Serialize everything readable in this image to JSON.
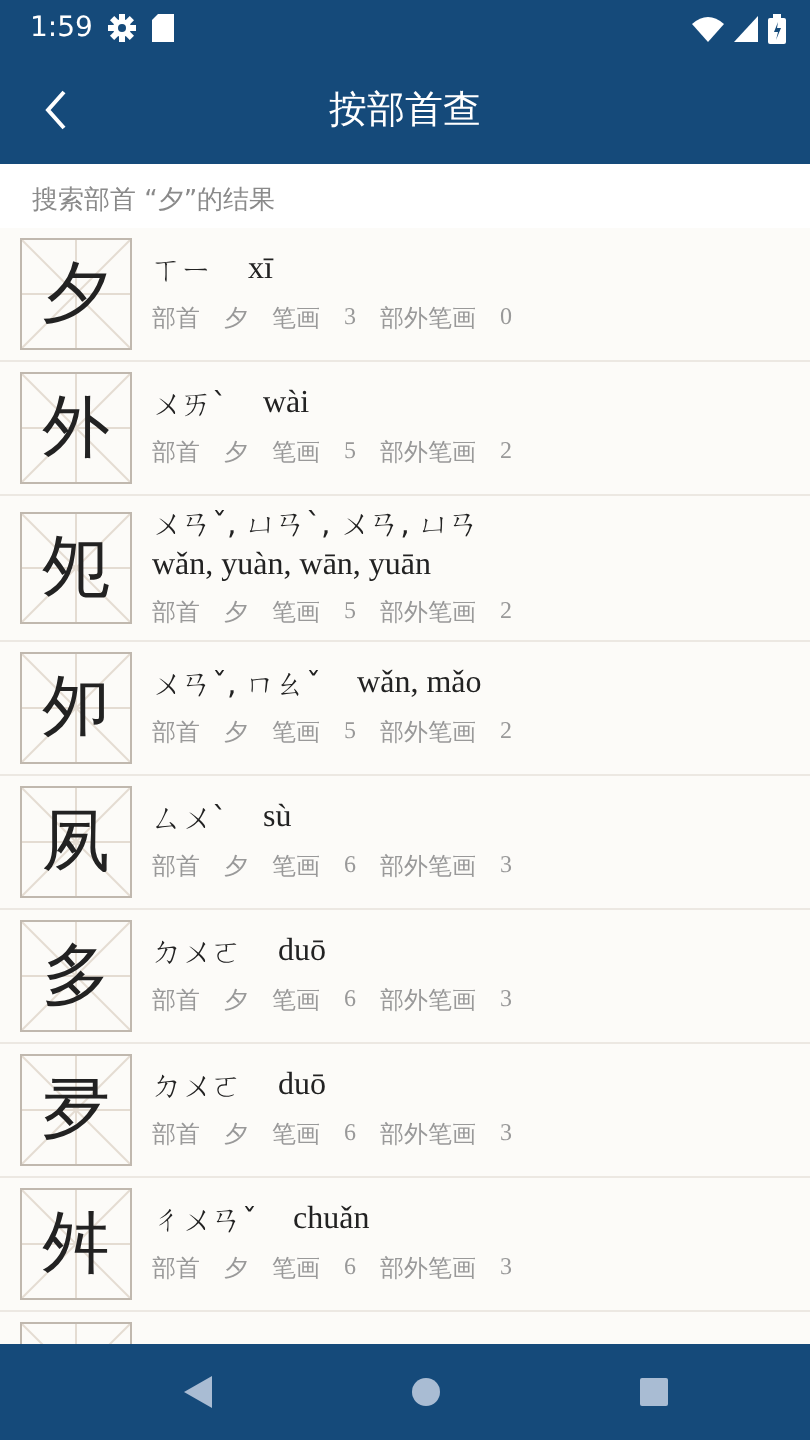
{
  "status_bar": {
    "time": "1:59"
  },
  "app_bar": {
    "title": "按部首查"
  },
  "subheader": "搜索部首 “夕”的结果",
  "rows": [
    {
      "character": "夕",
      "bopomofo": "ㄒㄧ",
      "pinyin": "xī",
      "meta": [
        {
          "label": "部首",
          "value": "夕"
        },
        {
          "label": "笔画",
          "value": "3"
        },
        {
          "label": "部外笔画",
          "value": "0"
        }
      ]
    },
    {
      "character": "外",
      "bopomofo": "ㄨㄞˋ",
      "pinyin": "wài",
      "meta": [
        {
          "label": "部首",
          "value": "夕"
        },
        {
          "label": "笔画",
          "value": "5"
        },
        {
          "label": "部外笔画",
          "value": "2"
        }
      ]
    },
    {
      "character": "夗",
      "bopomofo": "ㄨㄢˇ, ㄩㄢˋ, ㄨㄢ, ㄩㄢ",
      "pinyin": "wǎn, yuàn, wān, yuān",
      "meta": [
        {
          "label": "部首",
          "value": "夕"
        },
        {
          "label": "笔画",
          "value": "5"
        },
        {
          "label": "部外笔画",
          "value": "2"
        }
      ]
    },
    {
      "character": "夘",
      "bopomofo": "ㄨㄢˇ, ㄇㄠˇ",
      "pinyin": "wǎn, mǎo",
      "meta": [
        {
          "label": "部首",
          "value": "夕"
        },
        {
          "label": "笔画",
          "value": "5"
        },
        {
          "label": "部外笔画",
          "value": "2"
        }
      ]
    },
    {
      "character": "夙",
      "bopomofo": "ㄙㄨˋ",
      "pinyin": "sù",
      "meta": [
        {
          "label": "部首",
          "value": "夕"
        },
        {
          "label": "笔画",
          "value": "6"
        },
        {
          "label": "部外笔画",
          "value": "3"
        }
      ]
    },
    {
      "character": "多",
      "bopomofo": "ㄉㄨㄛ",
      "pinyin": "duō",
      "meta": [
        {
          "label": "部首",
          "value": "夕"
        },
        {
          "label": "笔画",
          "value": "6"
        },
        {
          "label": "部外笔画",
          "value": "3"
        }
      ]
    },
    {
      "character": "夛",
      "bopomofo": "ㄉㄨㄛ",
      "pinyin": "duō",
      "meta": [
        {
          "label": "部首",
          "value": "夕"
        },
        {
          "label": "笔画",
          "value": "6"
        },
        {
          "label": "部外笔画",
          "value": "3"
        }
      ]
    },
    {
      "character": "舛",
      "bopomofo": "ㄔㄨㄢˇ",
      "pinyin": "chuǎn",
      "meta": [
        {
          "label": "部首",
          "value": "夕"
        },
        {
          "label": "笔画",
          "value": "6"
        },
        {
          "label": "部外笔画",
          "value": "3"
        }
      ]
    }
  ]
}
